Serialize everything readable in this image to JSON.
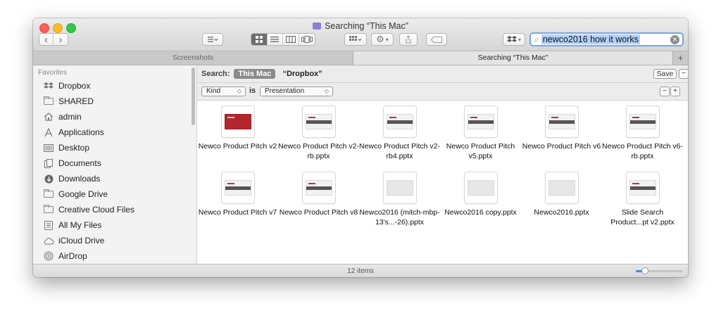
{
  "window": {
    "title": "Searching “This Mac”"
  },
  "toolbar": {
    "back": "‹",
    "forward": "›",
    "arrange_icon": "arrange-icon",
    "view_icons": [
      "icon-view-icon",
      "list-view-icon",
      "column-view-icon",
      "cover-flow-icon"
    ],
    "active_view": "icon-view-icon",
    "group_icon": "group-icon",
    "action_icon": "gear-icon",
    "share_icon": "share-icon",
    "tag_icon": "tag-icon",
    "dropbox_icon": "dropbox-icon",
    "search": {
      "query": "newco2016 how it works"
    }
  },
  "tabs": [
    {
      "label": "Screenshots",
      "active": false
    },
    {
      "label": "Searching “This Mac”",
      "active": true
    }
  ],
  "tab_add": "+",
  "sidebar": {
    "section": "Favorites",
    "items": [
      {
        "label": "Dropbox",
        "icon": "dropbox-icon"
      },
      {
        "label": "SHARED",
        "icon": "folder-icon"
      },
      {
        "label": "admin",
        "icon": "home-icon"
      },
      {
        "label": "Applications",
        "icon": "applications-icon"
      },
      {
        "label": "Desktop",
        "icon": "desktop-icon"
      },
      {
        "label": "Documents",
        "icon": "documents-icon"
      },
      {
        "label": "Downloads",
        "icon": "downloads-icon"
      },
      {
        "label": "Google Drive",
        "icon": "folder-icon"
      },
      {
        "label": "Creative Cloud Files",
        "icon": "folder-icon"
      },
      {
        "label": "All My Files",
        "icon": "all-files-icon"
      },
      {
        "label": "iCloud Drive",
        "icon": "cloud-icon"
      },
      {
        "label": "AirDrop",
        "icon": "airdrop-icon"
      }
    ]
  },
  "scope": {
    "label": "Search:",
    "active": "This Mac",
    "other": "“Dropbox”",
    "save": "Save",
    "remove": "−"
  },
  "criteria": {
    "attribute": "Kind",
    "operator": "is",
    "value": "Presentation",
    "remove": "−",
    "add": "+"
  },
  "files": [
    {
      "name": "Newco Product Pitch v2",
      "style": "red"
    },
    {
      "name": "Newco Product Pitch v2-rb.pptx",
      "style": "band"
    },
    {
      "name": "Newco Product Pitch v2-rb4.pptx",
      "style": "band"
    },
    {
      "name": "Newco Product Pitch v5.pptx",
      "style": "band"
    },
    {
      "name": "Newco Product Pitch v6",
      "style": "band"
    },
    {
      "name": "Newco Product Pitch v6-rb.pptx",
      "style": "band"
    },
    {
      "name": "Newco Product Pitch v7",
      "style": "band"
    },
    {
      "name": "Newco Product Pitch v8",
      "style": "band"
    },
    {
      "name": "Newco2016 (mitch-mbp-13's...-26).pptx",
      "style": "plain"
    },
    {
      "name": "Newco2016 copy.pptx",
      "style": "plain"
    },
    {
      "name": "Newco2016.pptx",
      "style": "plain"
    },
    {
      "name": "Slide Search Product...pt v2.pptx",
      "style": "band"
    }
  ],
  "status": {
    "text": "12 items",
    "icon_size": 0.2
  }
}
